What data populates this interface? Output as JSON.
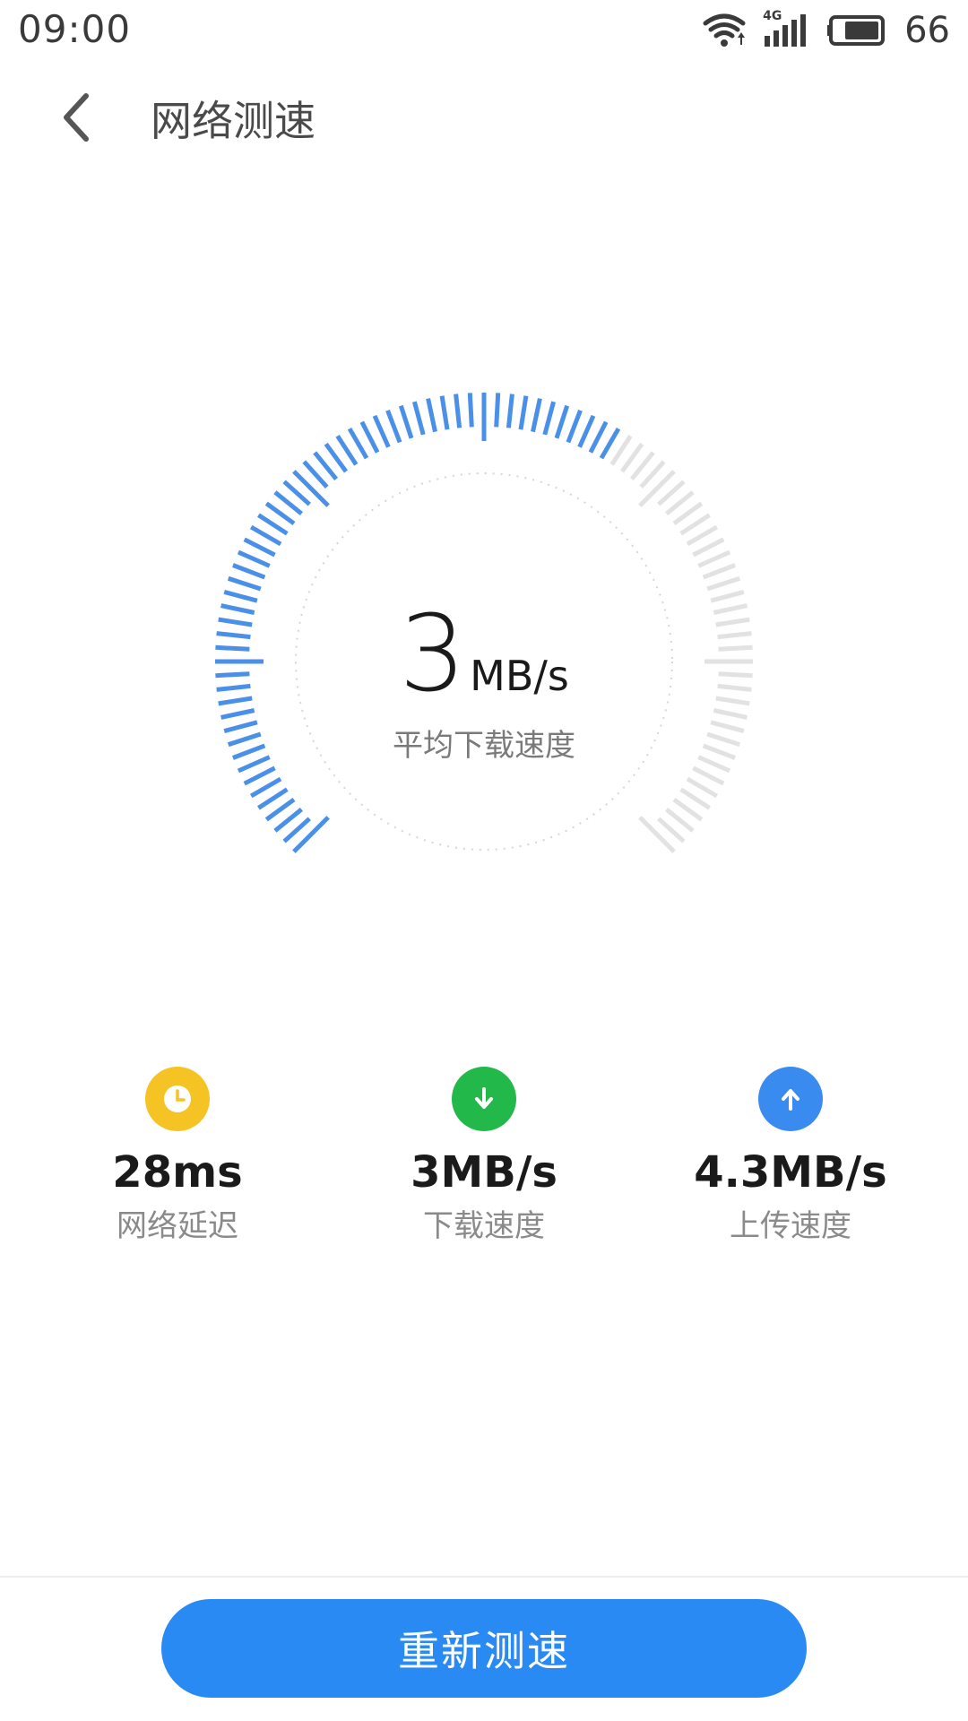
{
  "status_bar": {
    "time": "09:00",
    "network_type": "4G",
    "battery_level": "66",
    "icons": [
      "wifi-icon",
      "cellular-signal-icon",
      "battery-icon"
    ]
  },
  "header": {
    "back_icon": "chevron-left-icon",
    "title": "网络测速"
  },
  "gauge": {
    "speed_value": "3",
    "speed_unit": "MB/s",
    "label": "平均下载速度",
    "fill_fraction": 0.62,
    "active_color": "#4a90e8",
    "inactive_color": "#e2e2e2"
  },
  "stats": [
    {
      "icon": "clock-icon",
      "color": "#f6c325",
      "value": "28ms",
      "label": "网络延迟"
    },
    {
      "icon": "download-arrow-icon",
      "color": "#22b84a",
      "value": "3MB/s",
      "label": "下载速度"
    },
    {
      "icon": "upload-arrow-icon",
      "color": "#3a8bf0",
      "value": "4.3MB/s",
      "label": "上传速度"
    }
  ],
  "action": {
    "retest_label": "重新测速",
    "color": "#2a8af3"
  }
}
